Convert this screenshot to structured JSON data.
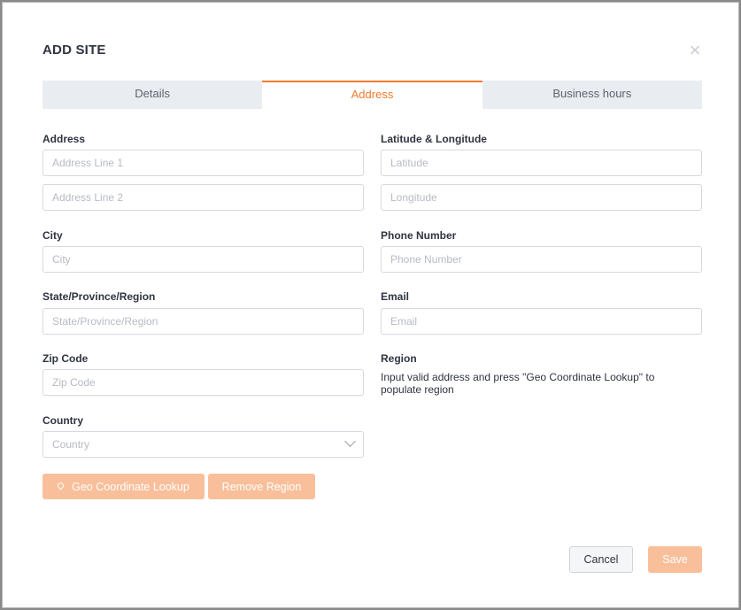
{
  "dialog": {
    "title": "ADD SITE",
    "close_glyph": "×"
  },
  "tabs": [
    {
      "label": "Details",
      "active": false
    },
    {
      "label": "Address",
      "active": true
    },
    {
      "label": "Business hours",
      "active": false
    }
  ],
  "form": {
    "address_label": "Address",
    "address_line1_placeholder": "Address Line 1",
    "address_line2_placeholder": "Address Line 2",
    "latlng_label": "Latitude & Longitude",
    "latitude_placeholder": "Latitude",
    "longitude_placeholder": "Longitude",
    "city_label": "City",
    "city_placeholder": "City",
    "phone_label": "Phone Number",
    "phone_placeholder": "Phone Number",
    "state_label": "State/Province/Region",
    "state_placeholder": "State/Province/Region",
    "email_label": "Email",
    "email_placeholder": "Email",
    "zip_label": "Zip Code",
    "zip_placeholder": "Zip Code",
    "region_label": "Region",
    "region_hint": "Input valid address and press \"Geo Coordinate Lookup\" to populate region",
    "country_label": "Country",
    "country_placeholder": "Country"
  },
  "actions": {
    "geo_lookup": "Geo Coordinate Lookup",
    "remove_region": "Remove Region",
    "cancel": "Cancel",
    "save": "Save"
  },
  "colors": {
    "accent": "#f07a2c",
    "accent_disabled": "#f9bf9a"
  }
}
